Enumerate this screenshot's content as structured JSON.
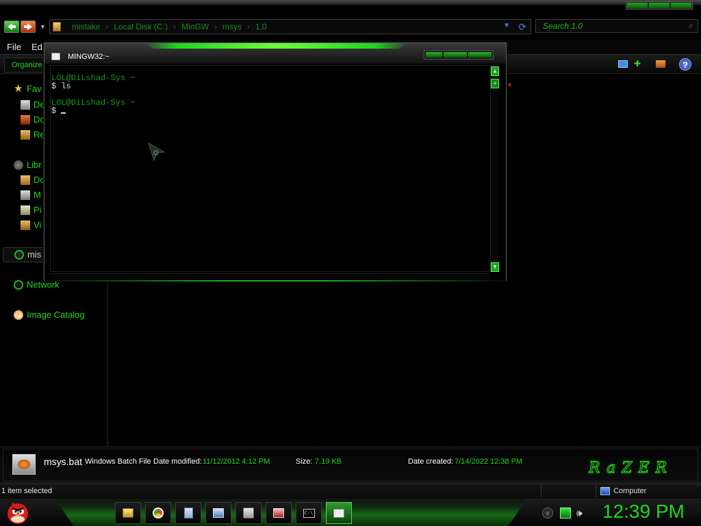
{
  "explorer": {
    "address_crumbs": [
      "mistake",
      "Local Disk (C:)",
      "MinGW",
      "msys",
      "1.0"
    ],
    "search_placeholder": "Search 1.0",
    "menu": {
      "file": "File",
      "edit": "Ed"
    },
    "organize_label": "Organize",
    "sidebar": {
      "favorites": "Fav",
      "fav_items": [
        "De",
        "Do",
        "Re"
      ],
      "libraries": "Libr",
      "lib_items": [
        "Do",
        "M",
        "Pi",
        "Vi"
      ],
      "selected": "mis",
      "network": "Network",
      "image_catalog": "Image Catalog"
    }
  },
  "terminal": {
    "title": "MINGW32:~",
    "lines": [
      {
        "prompt": "LOL@DiLshad-Sys ~"
      },
      {
        "cmd": "$ ls"
      },
      {
        "gap": true
      },
      {
        "prompt": "LOL@DiLshad-Sys ~"
      },
      {
        "cmd": "$ "
      }
    ]
  },
  "details": {
    "file_name": "msys.bat",
    "file_type": "Windows Batch File",
    "date_modified_label": "Date modified:",
    "date_modified": "11/12/2012 4:12 PM",
    "size_label": "Size:",
    "size": "7.19 KB",
    "date_created_label": "Date created:",
    "date_created": "7/14/2022 12:38 PM",
    "brand": "RaZER"
  },
  "statusbar": {
    "selection": "1 item selected",
    "location": "Computer"
  },
  "taskbar": {
    "apps": [
      "folder-icon",
      "chrome-icon",
      "notepad-icon",
      "monitor-icon",
      "media-icon",
      "disc-icon",
      "cmd-icon",
      "window-icon"
    ],
    "clock": "12:39 PM"
  },
  "colors": {
    "accent": "#1ed81e",
    "background": "#000000"
  }
}
